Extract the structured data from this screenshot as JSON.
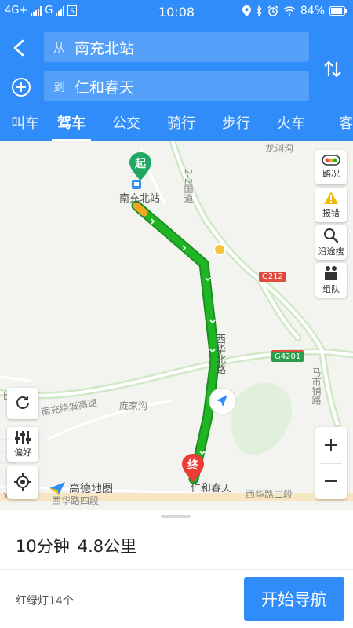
{
  "status_bar": {
    "network1": "4G+",
    "network2": "G",
    "time": "10:08",
    "battery": "84%"
  },
  "search": {
    "from_prefix": "从",
    "from_value": "南充北站",
    "to_prefix": "到",
    "to_value": "仁和春天"
  },
  "tabs": [
    {
      "label": "叫车"
    },
    {
      "label": "驾车"
    },
    {
      "label": "公交"
    },
    {
      "label": "骑行"
    },
    {
      "label": "步行"
    },
    {
      "label": "火车"
    },
    {
      "label": "客"
    }
  ],
  "active_tab": "驾车",
  "map": {
    "labels": {
      "longdonggou": "龙洞沟",
      "station": "南充北站",
      "road_212_v": "2-2国道",
      "xihua_road": "西华北路",
      "ring_highway": "南充绕城高速",
      "pangjiagou": "庞家沟",
      "xihua_4": "西华路四段",
      "xihua_2": "西华路二段",
      "destination": "仁和春天",
      "mashi_road": "马市铺路",
      "letter_b": "b",
      "letter_x": "x"
    },
    "badges": {
      "g212": "G212",
      "g4201": "G4201"
    },
    "start_pin": "起",
    "end_pin": "终",
    "logo": "高德地图",
    "colors": {
      "route_green": "#1fb524",
      "route_yellow": "#f5a623",
      "road_badge_red": "#e0493e",
      "road_badge_green": "#2a9d4b",
      "start_pin": "#21a760",
      "end_pin": "#ec3a35",
      "accent": "#2f8cf8"
    }
  },
  "side_buttons": {
    "traffic": "路况",
    "report": "报错",
    "search_along": "沿途搜",
    "team": "组队",
    "preference": "偏好"
  },
  "route": {
    "duration": "10分钟",
    "distance": "4.8公里",
    "traffic_lights": "红绿灯14个",
    "start_button": "开始导航"
  }
}
